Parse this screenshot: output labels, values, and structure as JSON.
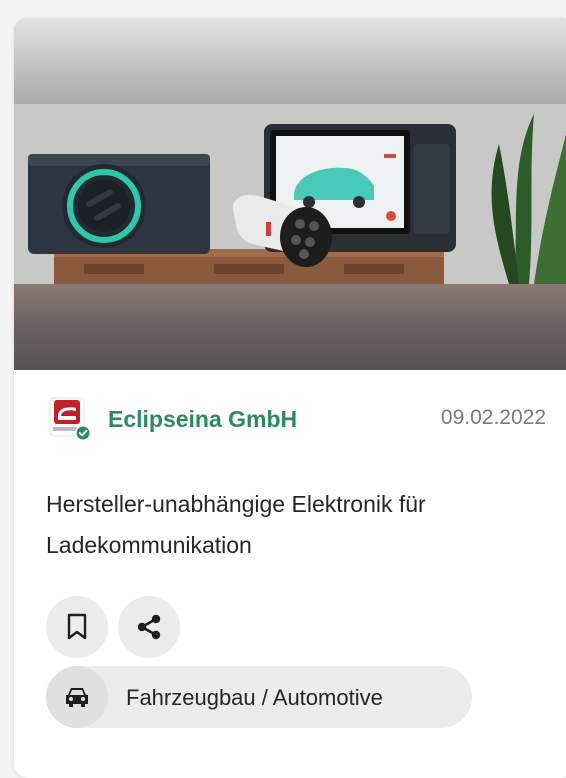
{
  "card": {
    "company": {
      "name": "Eclipseina GmbH",
      "logo_text": "Eclipseina",
      "verified": true,
      "brand_color": "#2d8a5f",
      "logo_color": "#c0202a"
    },
    "date": "09.02.2022",
    "title": "Hersteller-unabhängige Elektronik für Ladekommunikation",
    "actions": [
      {
        "icon": "bookmark-icon"
      },
      {
        "icon": "share-icon"
      }
    ],
    "category": {
      "icon": "car-icon",
      "label": "Fahrzeugbau / Automotive"
    },
    "image": {
      "alt": "Ladeelektronik-Geräte mit Ladestecker"
    }
  }
}
